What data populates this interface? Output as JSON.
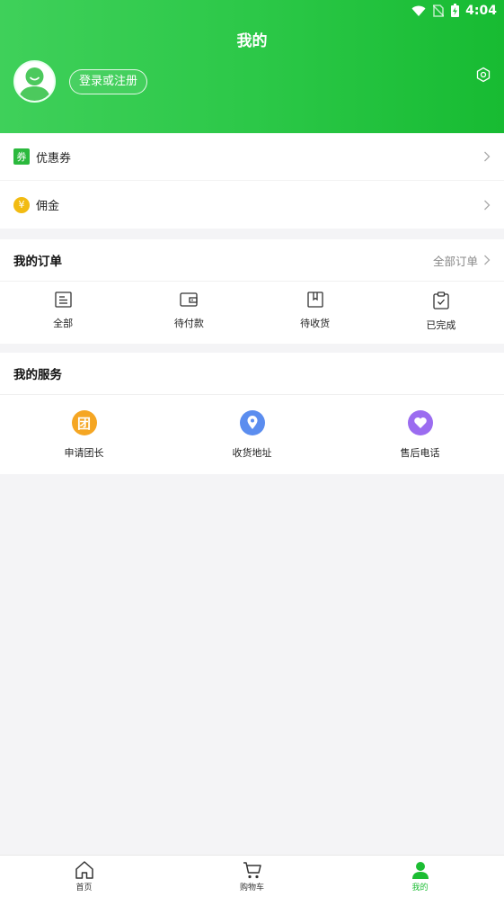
{
  "status": {
    "time": "4:04"
  },
  "header": {
    "title": "我的",
    "login_label": "登录或注册"
  },
  "accounts": [
    {
      "label": "优惠券",
      "icon": "coupon-icon",
      "badge": "券",
      "color": "#2bb93d"
    },
    {
      "label": "佣金",
      "icon": "yen-icon",
      "badge": "¥",
      "color": "#f2bb12"
    }
  ],
  "orders": {
    "title": "我的订单",
    "all_label": "全部订单",
    "items": [
      {
        "label": "全部",
        "icon": "list-icon"
      },
      {
        "label": "待付款",
        "icon": "wallet-icon"
      },
      {
        "label": "待收货",
        "icon": "box-icon"
      },
      {
        "label": "已完成",
        "icon": "clipboard-check-icon"
      }
    ]
  },
  "services": {
    "title": "我的服务",
    "items": [
      {
        "label": "申请团长",
        "icon": "group-icon",
        "glyph": "团",
        "color": "#f5a623"
      },
      {
        "label": "收货地址",
        "icon": "location-pin-icon",
        "color": "#5b8def"
      },
      {
        "label": "售后电话",
        "icon": "heart-icon",
        "color": "#9b6cf0"
      }
    ]
  },
  "tabbar": [
    {
      "label": "首页",
      "icon": "home-icon"
    },
    {
      "label": "购物车",
      "icon": "cart-icon"
    },
    {
      "label": "我的",
      "icon": "user-icon",
      "active": true
    }
  ]
}
